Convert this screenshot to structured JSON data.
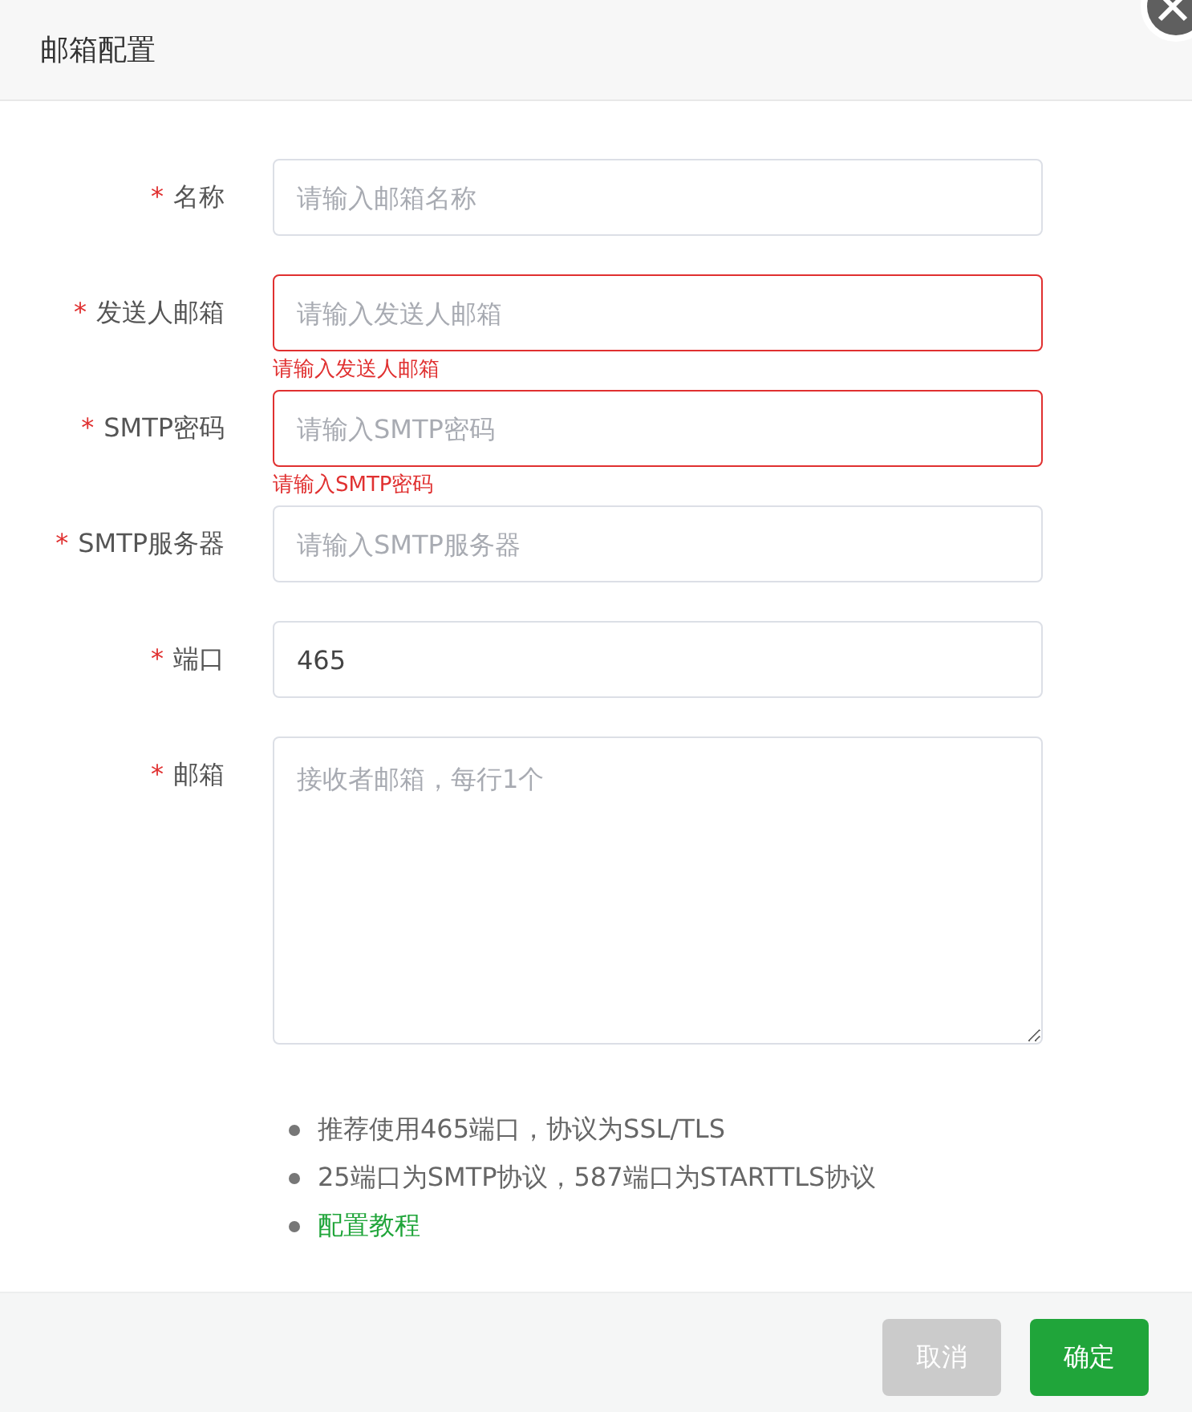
{
  "dialog": {
    "title": "邮箱配置"
  },
  "fields": [
    {
      "kind": "input",
      "required_mark": "*",
      "label": "名称",
      "placeholder": "请输入邮箱名称"
    },
    {
      "kind": "input",
      "required_mark": "*",
      "label": "发送人邮箱",
      "placeholder": "请输入发送人邮箱",
      "error": "请输入发送人邮箱"
    },
    {
      "kind": "input",
      "required_mark": "*",
      "label": "SMTP密码",
      "placeholder": "请输入SMTP密码",
      "error": "请输入SMTP密码"
    },
    {
      "kind": "input",
      "required_mark": "*",
      "label": "SMTP服务器",
      "placeholder": "请输入SMTP服务器"
    },
    {
      "kind": "input",
      "required_mark": "*",
      "label": "端口",
      "value": "465"
    },
    {
      "kind": "textarea",
      "required_mark": "*",
      "label": "邮箱",
      "placeholder": "接收者邮箱，每行1个"
    }
  ],
  "tips": [
    {
      "kind": "text",
      "text": "推荐使用465端口，协议为SSL/TLS"
    },
    {
      "kind": "text",
      "text": "25端口为SMTP协议，587端口为STARTTLS协议"
    },
    {
      "kind": "link",
      "text": "配置教程"
    }
  ],
  "buttons": [
    {
      "label": "取消",
      "kind": "secondary"
    },
    {
      "label": "确定",
      "kind": "primary"
    }
  ]
}
